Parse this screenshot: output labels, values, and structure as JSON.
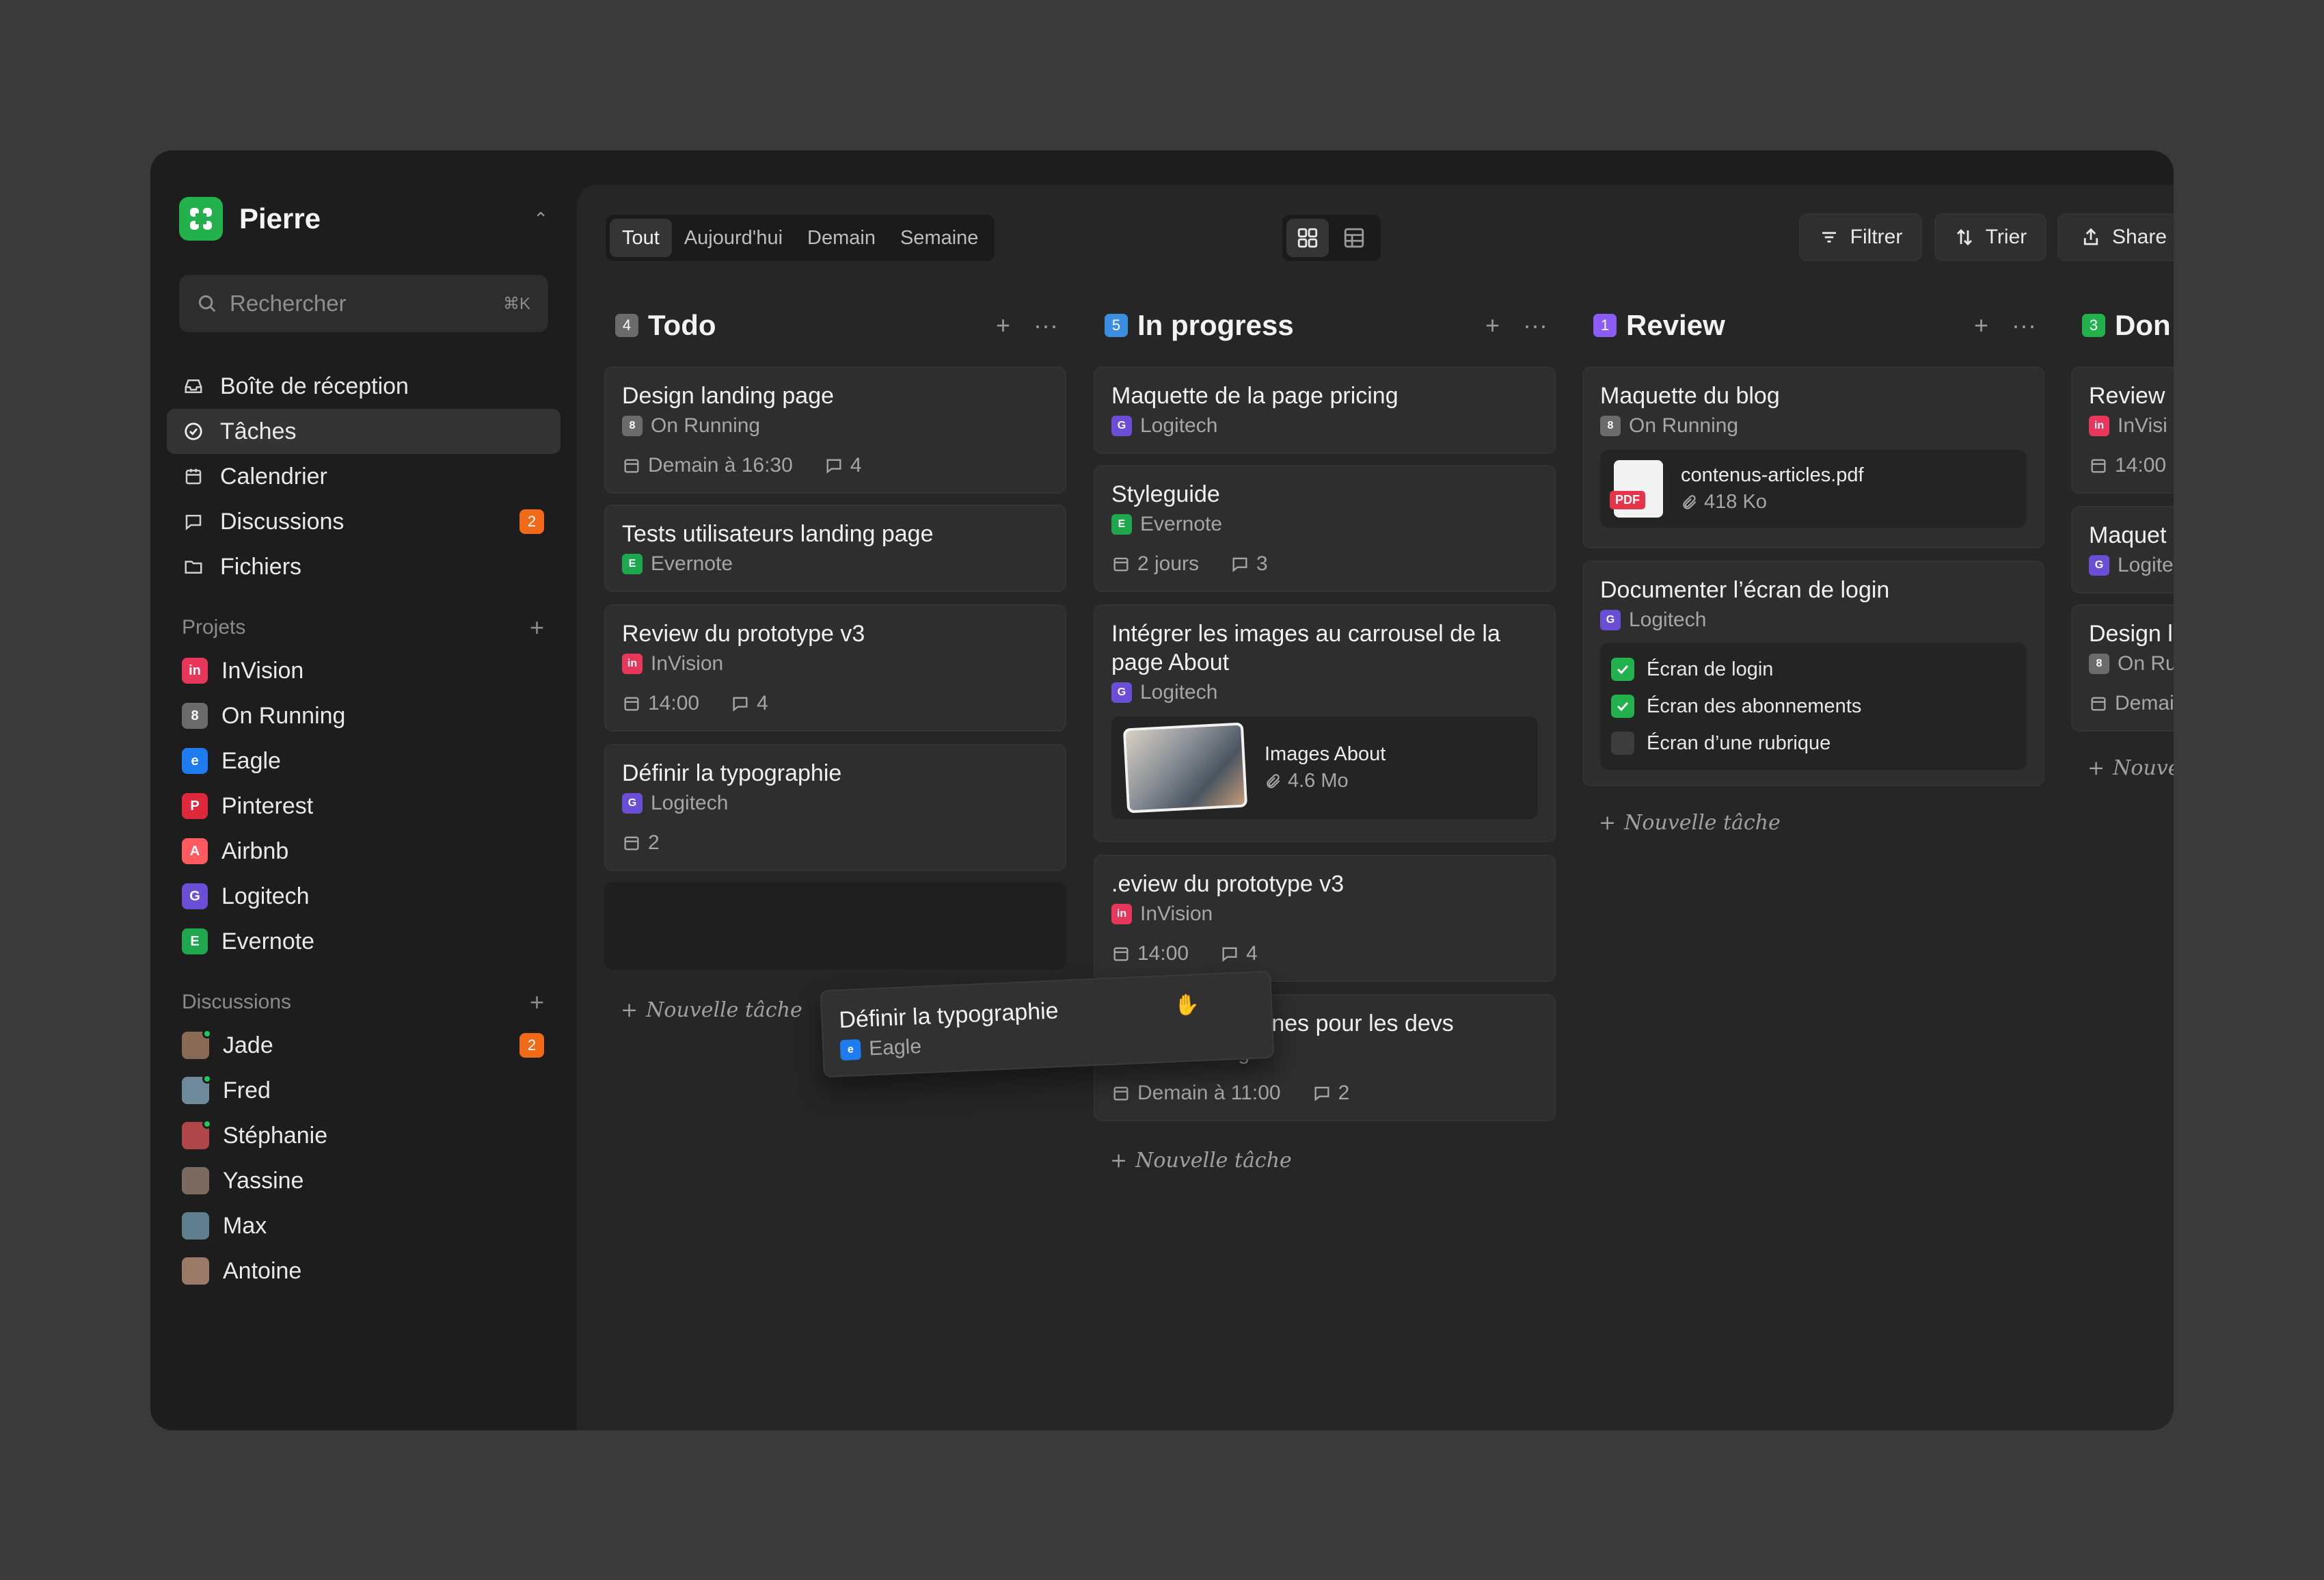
{
  "workspace": {
    "name": "Pierre"
  },
  "search": {
    "placeholder": "Rechercher",
    "shortcut": "⌘K"
  },
  "nav": [
    {
      "label": "Boîte de réception",
      "icon": "inbox-icon"
    },
    {
      "label": "Tâches",
      "icon": "check-circle-icon",
      "active": true
    },
    {
      "label": "Calendrier",
      "icon": "calendar-icon"
    },
    {
      "label": "Discussions",
      "icon": "chat-icon",
      "badge": "2"
    },
    {
      "label": "Fichiers",
      "icon": "folder-icon"
    }
  ],
  "projects": {
    "title": "Projets",
    "items": [
      {
        "label": "InVision",
        "color": "#e8375b",
        "glyph": "in"
      },
      {
        "label": "On Running",
        "color": "#6b6b6b",
        "glyph": "8"
      },
      {
        "label": "Eagle",
        "color": "#1e7bf0",
        "glyph": "e"
      },
      {
        "label": "Pinterest",
        "color": "#e0283c",
        "glyph": "P"
      },
      {
        "label": "Airbnb",
        "color": "#ff5a5f",
        "glyph": "A"
      },
      {
        "label": "Logitech",
        "color": "#6a4fd6",
        "glyph": "G"
      },
      {
        "label": "Evernote",
        "color": "#1fa74d",
        "glyph": "E"
      }
    ]
  },
  "discussions": {
    "title": "Discussions",
    "items": [
      {
        "label": "Jade",
        "badge": "2",
        "online": true,
        "color": "#8a6a55"
      },
      {
        "label": "Fred",
        "online": true,
        "color": "#6e8a9a"
      },
      {
        "label": "Stéphanie",
        "online": true,
        "color": "#b0454a"
      },
      {
        "label": "Yassine",
        "color": "#7a6a60"
      },
      {
        "label": "Max",
        "color": "#5f7f8f"
      },
      {
        "label": "Antoine",
        "color": "#9a7a66"
      }
    ]
  },
  "filters": [
    "Tout",
    "Aujourd'hui",
    "Demain",
    "Semaine"
  ],
  "toolbar": {
    "filter": "Filtrer",
    "sort": "Trier",
    "share": "Share"
  },
  "columns": [
    {
      "title": "Todo",
      "count": "4",
      "color": "#6b6b6b",
      "cards": [
        {
          "title": "Design landing page",
          "project": "On Running",
          "date": "Demain à 16:30",
          "comments": "4"
        },
        {
          "title": "Tests utilisateurs landing page",
          "project": "Evernote"
        },
        {
          "title": "Review du prototype v3",
          "project": "InVision",
          "date": "14:00",
          "comments": "4"
        },
        {
          "title": "Définir la typographie",
          "project": "Logitech",
          "date": "2"
        }
      ],
      "new_task": "Nouvelle tâche"
    },
    {
      "title": "In progress",
      "count": "5",
      "color": "#3b8fe0",
      "cards": [
        {
          "title": "Maquette de la page pricing",
          "project": "Logitech"
        },
        {
          "title": "Styleguide",
          "project": "Evernote",
          "date": "2 jours",
          "comments": "3"
        },
        {
          "title": "Intégrer les images au carrousel de la page About",
          "project": "Logitech",
          "attachment": {
            "name": "Images About",
            "size": "4.6 Mo"
          }
        },
        {
          "title": ".eview du prototype v3",
          "project": "InVision",
          "date": "14:00",
          "comments": "4"
        },
        {
          "title": "Exporter les icônes pour les devs",
          "project": "On Running",
          "date": "Demain à 11:00",
          "comments": "2"
        }
      ],
      "new_task": "Nouvelle tâche"
    },
    {
      "title": "Review",
      "count": "1",
      "color": "#8b5cf6",
      "cards": [
        {
          "title": "Maquette du blog",
          "project": "On Running",
          "attachment": {
            "name": "contenus-articles.pdf",
            "size": "418 Ko",
            "type": "PDF"
          }
        },
        {
          "title": "Documenter l’écran de login",
          "project": "Logitech",
          "checklist": [
            {
              "label": "Écran de login",
              "done": true
            },
            {
              "label": "Écran des abonnements",
              "done": true
            },
            {
              "label": "Écran d’une rubrique",
              "done": false
            }
          ]
        }
      ],
      "new_task": "Nouvelle tâche"
    },
    {
      "title": "Don",
      "count": "3",
      "color": "#22b14c",
      "cards": [
        {
          "title": "Review",
          "project": "InVisi",
          "date": "14:00"
        },
        {
          "title": "Maquet",
          "project": "Logite"
        },
        {
          "title": "Design l",
          "project": "On Ru",
          "date": "Demai"
        }
      ],
      "new_task": "Nouve"
    }
  ],
  "dragging": {
    "title": "Définir la typographie",
    "project": "Eagle"
  }
}
